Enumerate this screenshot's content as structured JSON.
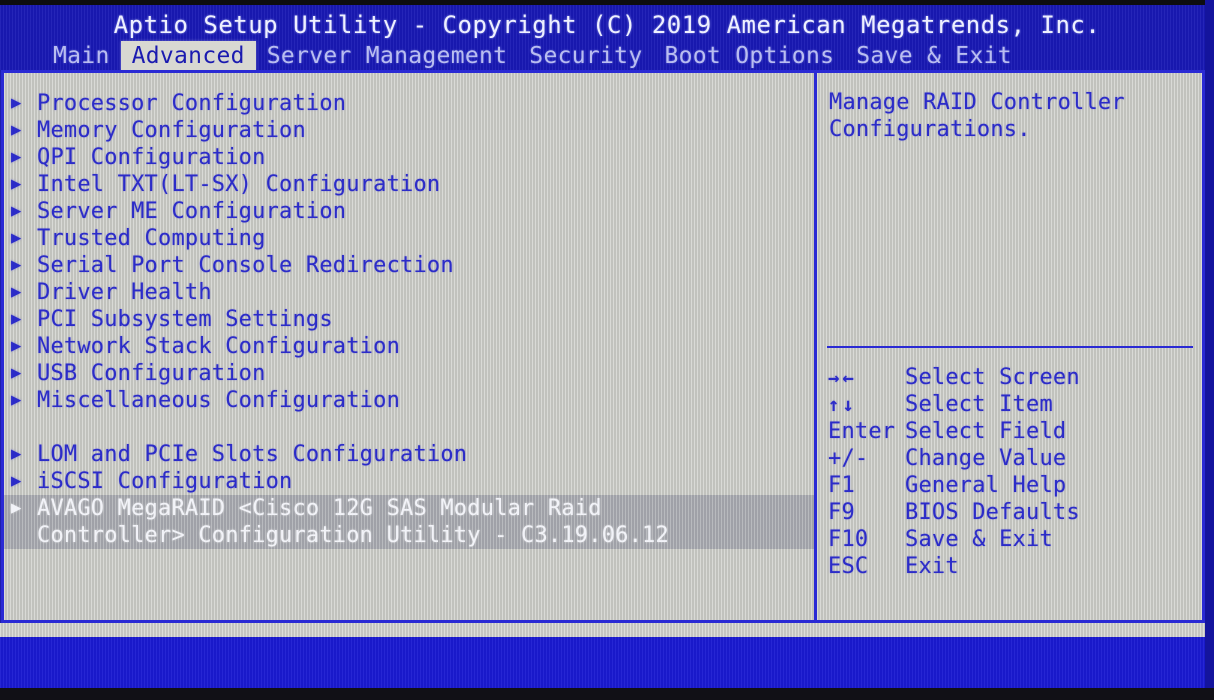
{
  "screen": {
    "title": "Aptio Setup Utility - Copyright (C) 2019 American Megatrends, Inc.",
    "colors": {
      "header_blue": "#1919b4",
      "panel_gray": "#c9cac4",
      "text_blue": "#2c2cc8",
      "selected_bg": "#a9abb0",
      "selected_text": "#f2f3f8",
      "border_blue": "#2a2ad4"
    }
  },
  "tabs": [
    {
      "label": "Main",
      "active": false
    },
    {
      "label": "Advanced",
      "active": true
    },
    {
      "label": "Server Management",
      "active": false
    },
    {
      "label": "Security",
      "active": false
    },
    {
      "label": "Boot Options",
      "active": false
    },
    {
      "label": "Save & Exit",
      "active": false
    }
  ],
  "menu": {
    "items": [
      {
        "type": "item",
        "arrow": "▶",
        "label": "Processor Configuration",
        "selected": false
      },
      {
        "type": "item",
        "arrow": "▶",
        "label": "Memory Configuration",
        "selected": false
      },
      {
        "type": "item",
        "arrow": "▶",
        "label": "QPI Configuration",
        "selected": false
      },
      {
        "type": "item",
        "arrow": "▶",
        "label": "Intel TXT(LT-SX) Configuration",
        "selected": false
      },
      {
        "type": "item",
        "arrow": "▶",
        "label": "Server ME Configuration",
        "selected": false
      },
      {
        "type": "item",
        "arrow": "▶",
        "label": "Trusted Computing",
        "selected": false
      },
      {
        "type": "item",
        "arrow": "▶",
        "label": "Serial Port Console Redirection",
        "selected": false
      },
      {
        "type": "item",
        "arrow": "▶",
        "label": "Driver Health",
        "selected": false
      },
      {
        "type": "item",
        "arrow": "▶",
        "label": "PCI Subsystem Settings",
        "selected": false
      },
      {
        "type": "item",
        "arrow": "▶",
        "label": "Network Stack Configuration",
        "selected": false
      },
      {
        "type": "item",
        "arrow": "▶",
        "label": "USB Configuration",
        "selected": false
      },
      {
        "type": "item",
        "arrow": "▶",
        "label": "Miscellaneous Configuration",
        "selected": false
      },
      {
        "type": "spacer"
      },
      {
        "type": "item",
        "arrow": "▶",
        "label": "LOM and PCIe Slots Configuration",
        "selected": false
      },
      {
        "type": "item",
        "arrow": "▶",
        "label": "iSCSI Configuration",
        "selected": false
      },
      {
        "type": "item",
        "arrow": "▶",
        "label": "AVAGO MegaRAID <Cisco 12G SAS Modular Raid",
        "label_line2": "Controller> Configuration Utility - C3.19.06.12",
        "selected": true
      }
    ]
  },
  "help": {
    "lines": [
      "Manage RAID Controller",
      "Configurations."
    ]
  },
  "legend": [
    {
      "key": "→←",
      "glyph": true,
      "desc": "Select Screen"
    },
    {
      "key": "↑↓",
      "glyph": true,
      "desc": "Select Item"
    },
    {
      "key": "Enter",
      "glyph": false,
      "desc": "Select Field"
    },
    {
      "key": "+/-",
      "glyph": false,
      "desc": "Change Value"
    },
    {
      "key": "F1",
      "glyph": false,
      "desc": "General Help"
    },
    {
      "key": "F9",
      "glyph": false,
      "desc": "BIOS Defaults"
    },
    {
      "key": "F10",
      "glyph": false,
      "desc": "Save & Exit"
    },
    {
      "key": "ESC",
      "glyph": false,
      "desc": "Exit"
    }
  ]
}
